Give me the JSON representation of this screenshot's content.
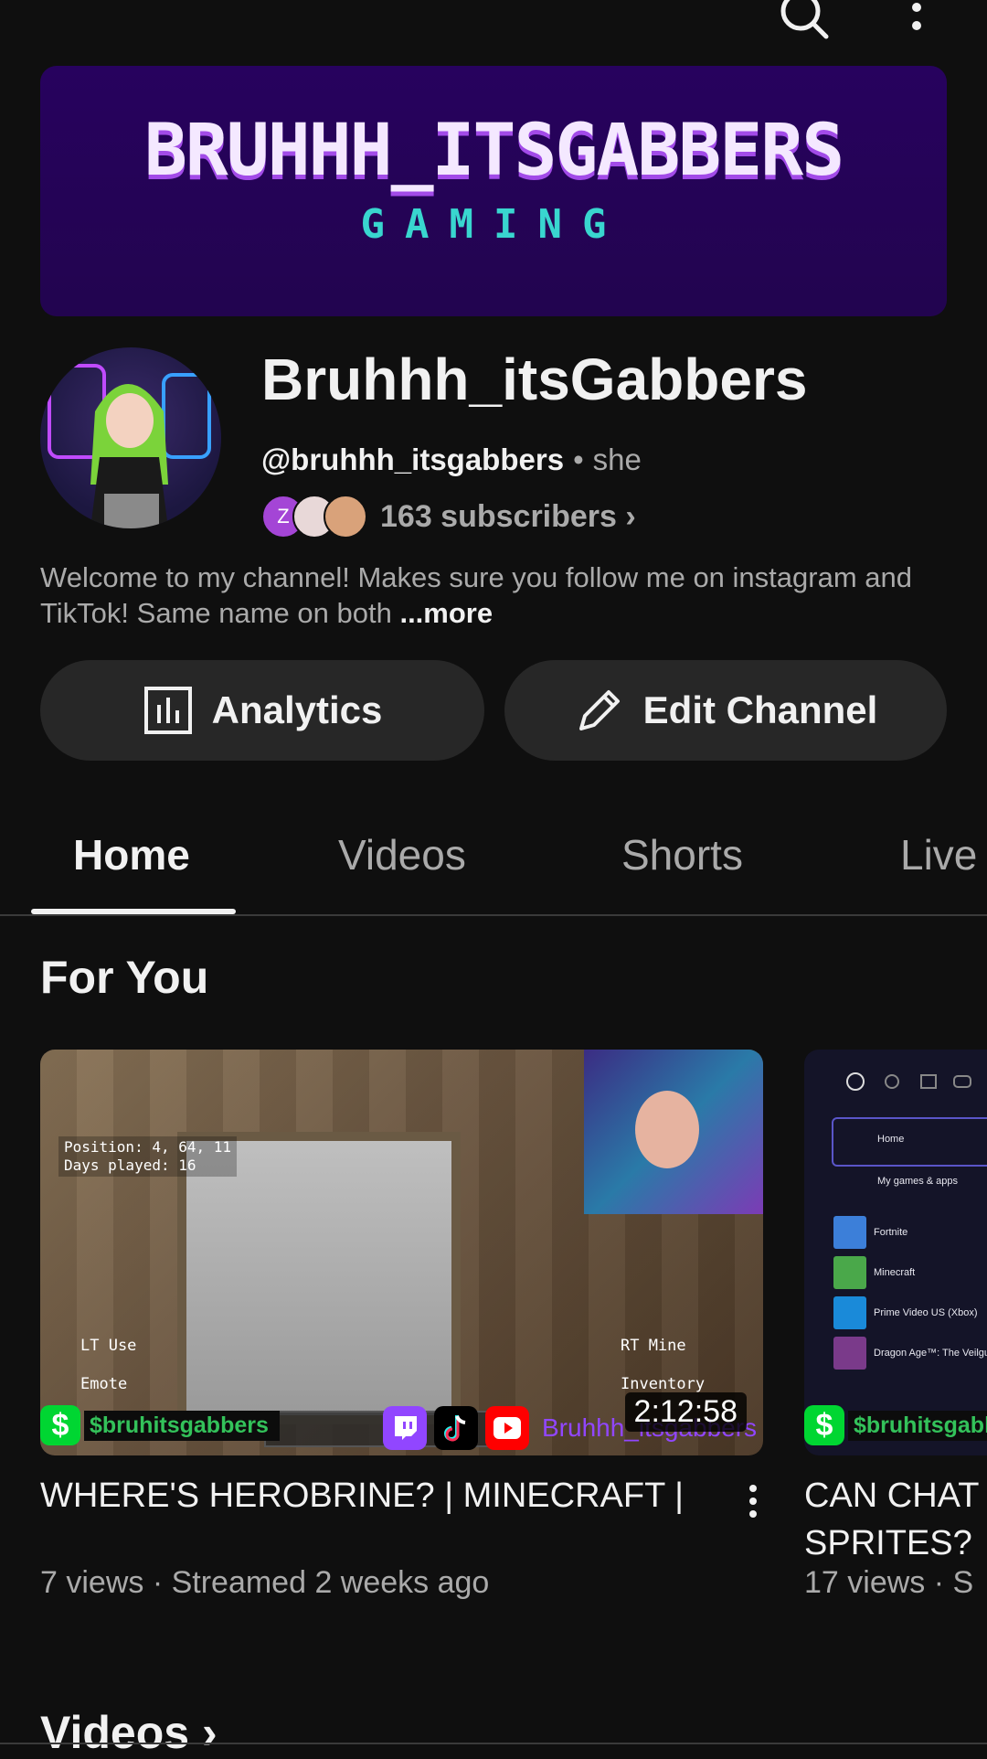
{
  "banner": {
    "title": "BRUHHH_ITSGABBERS",
    "subtitle": "GAMING"
  },
  "channel": {
    "name": "Bruhhh_itsGabbers",
    "handle": "@bruhhh_itsgabbers",
    "separator": "•",
    "pronouns": "she",
    "subscriber_avatar_letter": "Z",
    "subscribers": "163 subscribers",
    "subscribers_chevron": "›",
    "description": "Welcome to my channel! Makes sure you follow me on instagram and TikTok! Same name on both",
    "description_more": "...more"
  },
  "actions": {
    "analytics_label": "Analytics",
    "edit_label": "Edit Channel"
  },
  "tabs": [
    {
      "label": "Home"
    },
    {
      "label": "Videos"
    },
    {
      "label": "Shorts"
    },
    {
      "label": "Live"
    }
  ],
  "section_title": "For You",
  "videos": [
    {
      "title": "WHERE'S HEROBRINE? | MINECRAFT |",
      "meta": "7 views · Streamed 2 weeks ago",
      "duration": "2:12:58",
      "cashtag": "$bruhitsgabbers",
      "social_name": "Bruhhh_itsgabbers",
      "hud_position": "Position: 4, 64, 11",
      "hud_days": "Days played: 16",
      "ctl_use": "LT Use",
      "ctl_emote": "Emote",
      "ctl_mine": "RT Mine",
      "ctl_inventory": "Inventory"
    },
    {
      "title_line1": "CAN CHAT",
      "title_line2": "SPRITES?",
      "meta": "17 views · S",
      "cashtag": "$bruhitsgabl",
      "menu_home": "Home",
      "menu_games": "My games & apps",
      "games": [
        "Fortnite",
        "Minecraft",
        "Prime Video US (Xbox)",
        "Dragon Age™: The Veilguard"
      ]
    }
  ],
  "videos_section": {
    "title": "Videos",
    "chevron": "›"
  },
  "colors": {
    "background": "#0f0f0f",
    "banner": "#27025e",
    "pill": "#272727",
    "muted_text": "#aaaaaa",
    "cashapp": "#00d632",
    "twitch": "#9146ff"
  }
}
